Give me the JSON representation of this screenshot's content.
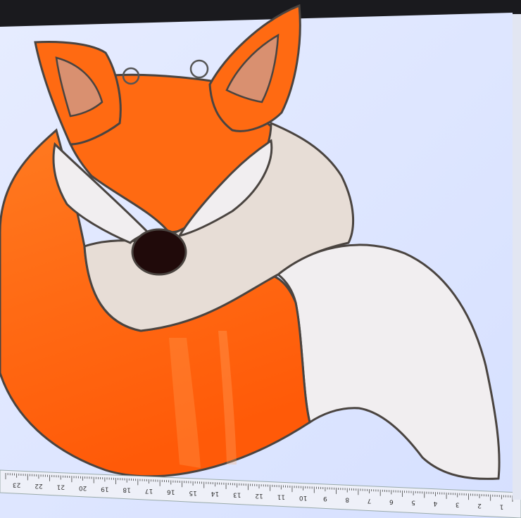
{
  "colors": {
    "lightbox": "#dce6ff",
    "orange": "#ff6a12",
    "orange_dark": "#e0520a",
    "white_glass": "#f1eef0",
    "cream_glass": "#e7ddd6",
    "ear_inner": "#d99070",
    "solder": "#4a4440",
    "nose": "#200a0a",
    "ruler": "#eef0f8",
    "background": "#1a1a1e"
  },
  "ruler": {
    "unit": "cm",
    "labels": [
      "23",
      "22",
      "21",
      "20",
      "19",
      "18",
      "17",
      "16",
      "15",
      "14",
      "13",
      "12",
      "11",
      "10",
      "9",
      "8",
      "7",
      "6",
      "5",
      "4",
      "3",
      "2",
      "1"
    ]
  }
}
